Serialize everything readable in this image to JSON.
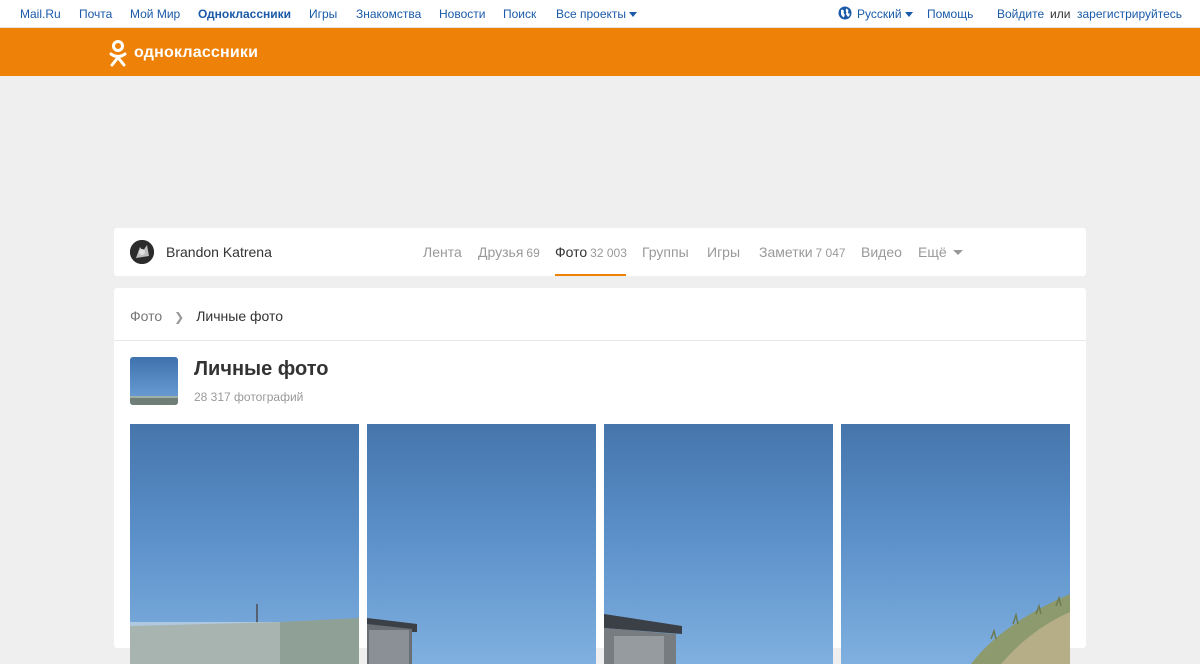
{
  "portal": {
    "links": [
      "Mail.Ru",
      "Почта",
      "Мой Мир",
      "Одноклассники",
      "Игры",
      "Знакомства",
      "Новости",
      "Поиск",
      "Все проекты"
    ],
    "active": "Одноклассники",
    "language": "Русский",
    "help": "Помощь",
    "login": "Войдите",
    "or": "или",
    "register": "зарегистрируйтесь"
  },
  "header": {
    "logo_text": "одноклассники",
    "brand_color": "#ee8208"
  },
  "profile": {
    "name": "Brandon Katrena",
    "tabs": [
      {
        "label": "Лента",
        "count": ""
      },
      {
        "label": "Друзья",
        "count": "69"
      },
      {
        "label": "Фото",
        "count": "32 003"
      },
      {
        "label": "Группы",
        "count": ""
      },
      {
        "label": "Игры",
        "count": ""
      },
      {
        "label": "Заметки",
        "count": "7 047"
      },
      {
        "label": "Видео",
        "count": ""
      },
      {
        "label": "Ещё",
        "count": ""
      }
    ],
    "active_tab": "Фото"
  },
  "breadcrumb": {
    "root": "Фото",
    "separator": "❯",
    "current": "Личные фото"
  },
  "album": {
    "title": "Личные фото",
    "count": "28 317 фотографий",
    "photos": [
      "photo-1",
      "photo-2",
      "photo-3",
      "photo-4"
    ]
  },
  "icons": {
    "language": "globe-icon",
    "dropdown": "chevron-down-icon",
    "logo": "ok-logo-icon"
  }
}
